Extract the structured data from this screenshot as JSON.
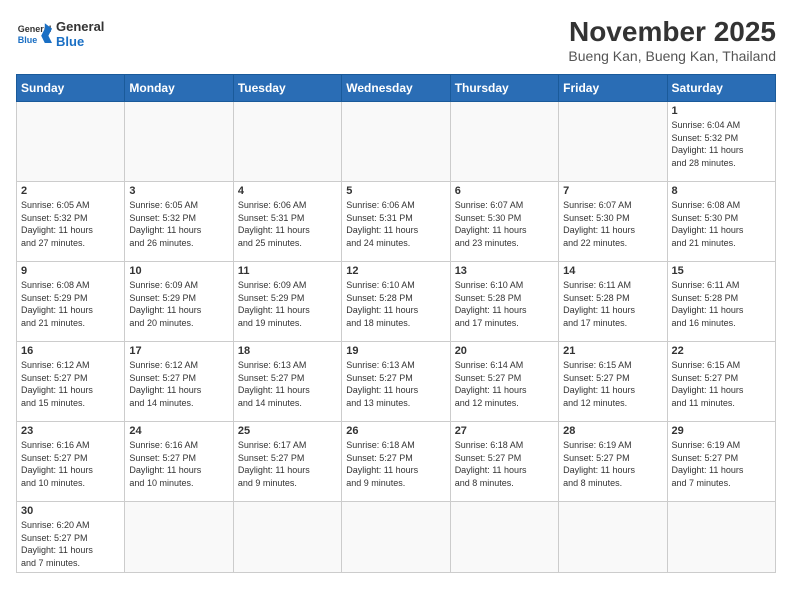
{
  "header": {
    "logo_general": "General",
    "logo_blue": "Blue",
    "month_title": "November 2025",
    "location": "Bueng Kan, Bueng Kan, Thailand"
  },
  "weekdays": [
    "Sunday",
    "Monday",
    "Tuesday",
    "Wednesday",
    "Thursday",
    "Friday",
    "Saturday"
  ],
  "weeks": [
    [
      {
        "day": "",
        "info": ""
      },
      {
        "day": "",
        "info": ""
      },
      {
        "day": "",
        "info": ""
      },
      {
        "day": "",
        "info": ""
      },
      {
        "day": "",
        "info": ""
      },
      {
        "day": "",
        "info": ""
      },
      {
        "day": "1",
        "info": "Sunrise: 6:04 AM\nSunset: 5:32 PM\nDaylight: 11 hours\nand 28 minutes."
      }
    ],
    [
      {
        "day": "2",
        "info": "Sunrise: 6:05 AM\nSunset: 5:32 PM\nDaylight: 11 hours\nand 27 minutes."
      },
      {
        "day": "3",
        "info": "Sunrise: 6:05 AM\nSunset: 5:32 PM\nDaylight: 11 hours\nand 26 minutes."
      },
      {
        "day": "4",
        "info": "Sunrise: 6:06 AM\nSunset: 5:31 PM\nDaylight: 11 hours\nand 25 minutes."
      },
      {
        "day": "5",
        "info": "Sunrise: 6:06 AM\nSunset: 5:31 PM\nDaylight: 11 hours\nand 24 minutes."
      },
      {
        "day": "6",
        "info": "Sunrise: 6:07 AM\nSunset: 5:30 PM\nDaylight: 11 hours\nand 23 minutes."
      },
      {
        "day": "7",
        "info": "Sunrise: 6:07 AM\nSunset: 5:30 PM\nDaylight: 11 hours\nand 22 minutes."
      },
      {
        "day": "8",
        "info": "Sunrise: 6:08 AM\nSunset: 5:30 PM\nDaylight: 11 hours\nand 21 minutes."
      }
    ],
    [
      {
        "day": "9",
        "info": "Sunrise: 6:08 AM\nSunset: 5:29 PM\nDaylight: 11 hours\nand 21 minutes."
      },
      {
        "day": "10",
        "info": "Sunrise: 6:09 AM\nSunset: 5:29 PM\nDaylight: 11 hours\nand 20 minutes."
      },
      {
        "day": "11",
        "info": "Sunrise: 6:09 AM\nSunset: 5:29 PM\nDaylight: 11 hours\nand 19 minutes."
      },
      {
        "day": "12",
        "info": "Sunrise: 6:10 AM\nSunset: 5:28 PM\nDaylight: 11 hours\nand 18 minutes."
      },
      {
        "day": "13",
        "info": "Sunrise: 6:10 AM\nSunset: 5:28 PM\nDaylight: 11 hours\nand 17 minutes."
      },
      {
        "day": "14",
        "info": "Sunrise: 6:11 AM\nSunset: 5:28 PM\nDaylight: 11 hours\nand 17 minutes."
      },
      {
        "day": "15",
        "info": "Sunrise: 6:11 AM\nSunset: 5:28 PM\nDaylight: 11 hours\nand 16 minutes."
      }
    ],
    [
      {
        "day": "16",
        "info": "Sunrise: 6:12 AM\nSunset: 5:27 PM\nDaylight: 11 hours\nand 15 minutes."
      },
      {
        "day": "17",
        "info": "Sunrise: 6:12 AM\nSunset: 5:27 PM\nDaylight: 11 hours\nand 14 minutes."
      },
      {
        "day": "18",
        "info": "Sunrise: 6:13 AM\nSunset: 5:27 PM\nDaylight: 11 hours\nand 14 minutes."
      },
      {
        "day": "19",
        "info": "Sunrise: 6:13 AM\nSunset: 5:27 PM\nDaylight: 11 hours\nand 13 minutes."
      },
      {
        "day": "20",
        "info": "Sunrise: 6:14 AM\nSunset: 5:27 PM\nDaylight: 11 hours\nand 12 minutes."
      },
      {
        "day": "21",
        "info": "Sunrise: 6:15 AM\nSunset: 5:27 PM\nDaylight: 11 hours\nand 12 minutes."
      },
      {
        "day": "22",
        "info": "Sunrise: 6:15 AM\nSunset: 5:27 PM\nDaylight: 11 hours\nand 11 minutes."
      }
    ],
    [
      {
        "day": "23",
        "info": "Sunrise: 6:16 AM\nSunset: 5:27 PM\nDaylight: 11 hours\nand 10 minutes."
      },
      {
        "day": "24",
        "info": "Sunrise: 6:16 AM\nSunset: 5:27 PM\nDaylight: 11 hours\nand 10 minutes."
      },
      {
        "day": "25",
        "info": "Sunrise: 6:17 AM\nSunset: 5:27 PM\nDaylight: 11 hours\nand 9 minutes."
      },
      {
        "day": "26",
        "info": "Sunrise: 6:18 AM\nSunset: 5:27 PM\nDaylight: 11 hours\nand 9 minutes."
      },
      {
        "day": "27",
        "info": "Sunrise: 6:18 AM\nSunset: 5:27 PM\nDaylight: 11 hours\nand 8 minutes."
      },
      {
        "day": "28",
        "info": "Sunrise: 6:19 AM\nSunset: 5:27 PM\nDaylight: 11 hours\nand 8 minutes."
      },
      {
        "day": "29",
        "info": "Sunrise: 6:19 AM\nSunset: 5:27 PM\nDaylight: 11 hours\nand 7 minutes."
      }
    ],
    [
      {
        "day": "30",
        "info": "Sunrise: 6:20 AM\nSunset: 5:27 PM\nDaylight: 11 hours\nand 7 minutes."
      },
      {
        "day": "",
        "info": ""
      },
      {
        "day": "",
        "info": ""
      },
      {
        "day": "",
        "info": ""
      },
      {
        "day": "",
        "info": ""
      },
      {
        "day": "",
        "info": ""
      },
      {
        "day": "",
        "info": ""
      }
    ]
  ]
}
